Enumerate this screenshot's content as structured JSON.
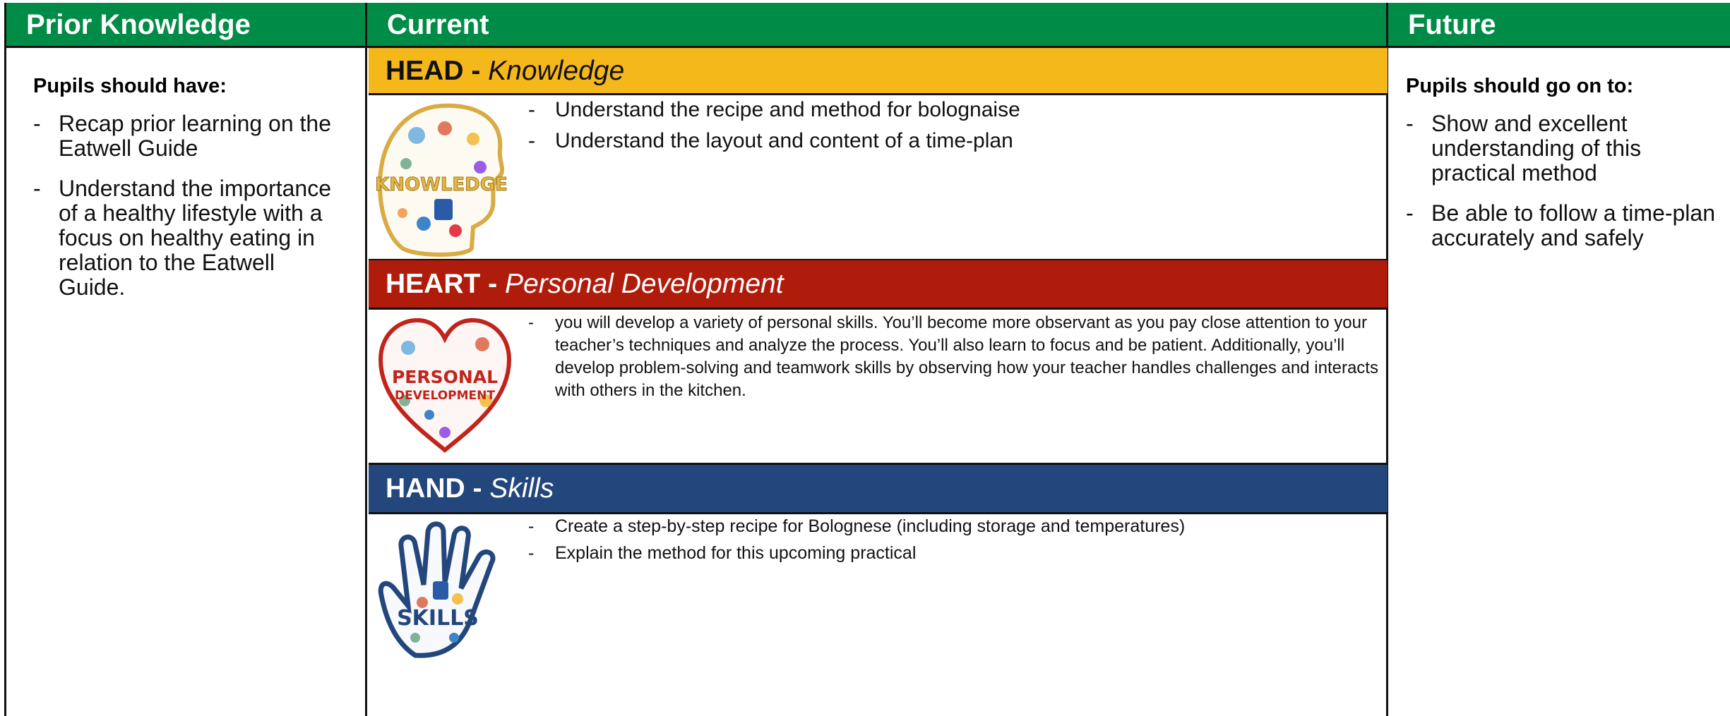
{
  "columns": {
    "prior": {
      "title": "Prior Knowledge",
      "subheading": "Pupils should have:",
      "items": [
        "Recap prior learning on the Eatwell Guide",
        "Understand the importance of a healthy lifestyle with a focus on healthy eating in relation to the Eatwell Guide."
      ]
    },
    "current": {
      "title": "Current",
      "head": {
        "label_bold": "HEAD - ",
        "label_italic": "Knowledge",
        "icon_text": "KNOWLEDGE",
        "icon": "knowledge-head-icon",
        "items": [
          "Understand the recipe and method for bolognaise",
          "Understand the layout and content of a time-plan"
        ]
      },
      "heart": {
        "label_bold": "HEART - ",
        "label_italic": "Personal Development",
        "icon_text_1": "PERSONAL",
        "icon_text_2": "DEVELOPMENT",
        "icon": "personal-development-heart-icon",
        "items": [
          "you will develop a variety of personal skills. You’ll become more observant as you pay close attention to your teacher’s techniques and analyze the process. You’ll also learn to focus and be patient. Additionally, you’ll develop problem-solving and teamwork skills by observing how your teacher handles challenges and interacts with others in the kitchen."
        ]
      },
      "hand": {
        "label_bold": "HAND - ",
        "label_italic": "Skills",
        "icon_text": "SKILLS",
        "icon": "skills-hand-icon",
        "items": [
          "Create a step-by-step recipe for Bolognese (including storage and temperatures)",
          "Explain the method for this upcoming practical"
        ]
      }
    },
    "future": {
      "title": "Future",
      "subheading": "Pupils should go on to:",
      "items": [
        "Show and excellent understanding of this practical method",
        "Be able to follow a time-plan accurately and safely"
      ]
    }
  },
  "colors": {
    "header_green": "#008c46",
    "head_yellow": "#f5b81a",
    "heart_red": "#b01c0c",
    "hand_blue": "#23467c"
  }
}
